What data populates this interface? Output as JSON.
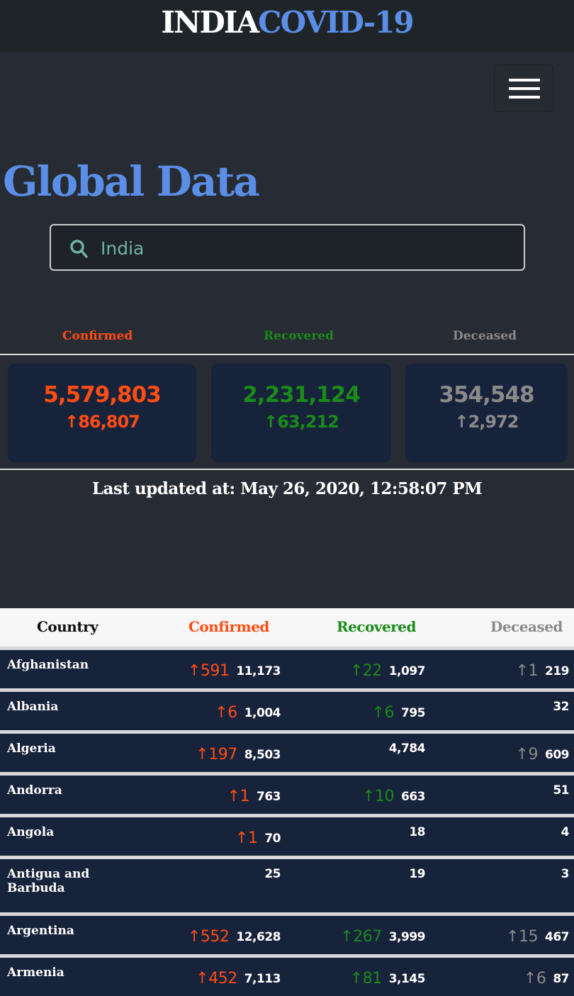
{
  "header": {
    "brand_part1": "INDIA",
    "brand_part2": "COVID-19"
  },
  "page_title": "Global Data",
  "search": {
    "value": "India",
    "placeholder": ""
  },
  "colors": {
    "confirmed": "#ff4d14",
    "recovered": "#1a8a1a",
    "deceased": "#8a8a8a",
    "accent": "#5b8ee6"
  },
  "summary": {
    "confirmed": {
      "label": "Confirmed",
      "total": "5,579,803",
      "delta": "↑86,807"
    },
    "recovered": {
      "label": "Recovered",
      "total": "2,231,124",
      "delta": "↑63,212"
    },
    "deceased": {
      "label": "Deceased",
      "total": "354,548",
      "delta": "↑2,972"
    }
  },
  "last_updated": "Last updated at: May 26, 2020, 12:58:07 PM",
  "table": {
    "headers": [
      "Country",
      "Confirmed",
      "Recovered",
      "Deceased"
    ],
    "rows": [
      {
        "country": "Afghanistan",
        "c_delta": "↑591",
        "c": "11,173",
        "r_delta": "↑22",
        "r": "1,097",
        "d_delta": "↑1",
        "d": "219"
      },
      {
        "country": "Albania",
        "c_delta": "↑6",
        "c": "1,004",
        "r_delta": "↑6",
        "r": "795",
        "d_delta": "",
        "d": "32"
      },
      {
        "country": "Algeria",
        "c_delta": "↑197",
        "c": "8,503",
        "r_delta": "",
        "r": "4,784",
        "d_delta": "↑9",
        "d": "609"
      },
      {
        "country": "Andorra",
        "c_delta": "↑1",
        "c": "763",
        "r_delta": "↑10",
        "r": "663",
        "d_delta": "",
        "d": "51"
      },
      {
        "country": "Angola",
        "c_delta": "↑1",
        "c": "70",
        "r_delta": "",
        "r": "18",
        "d_delta": "",
        "d": "4"
      },
      {
        "country": "Antigua and Barbuda",
        "c_delta": "",
        "c": "25",
        "r_delta": "",
        "r": "19",
        "d_delta": "",
        "d": "3"
      },
      {
        "country": "Argentina",
        "c_delta": "↑552",
        "c": "12,628",
        "r_delta": "↑267",
        "r": "3,999",
        "d_delta": "↑15",
        "d": "467"
      },
      {
        "country": "Armenia",
        "c_delta": "↑452",
        "c": "7,113",
        "r_delta": "↑81",
        "r": "3,145",
        "d_delta": "↑6",
        "d": "87"
      }
    ]
  }
}
